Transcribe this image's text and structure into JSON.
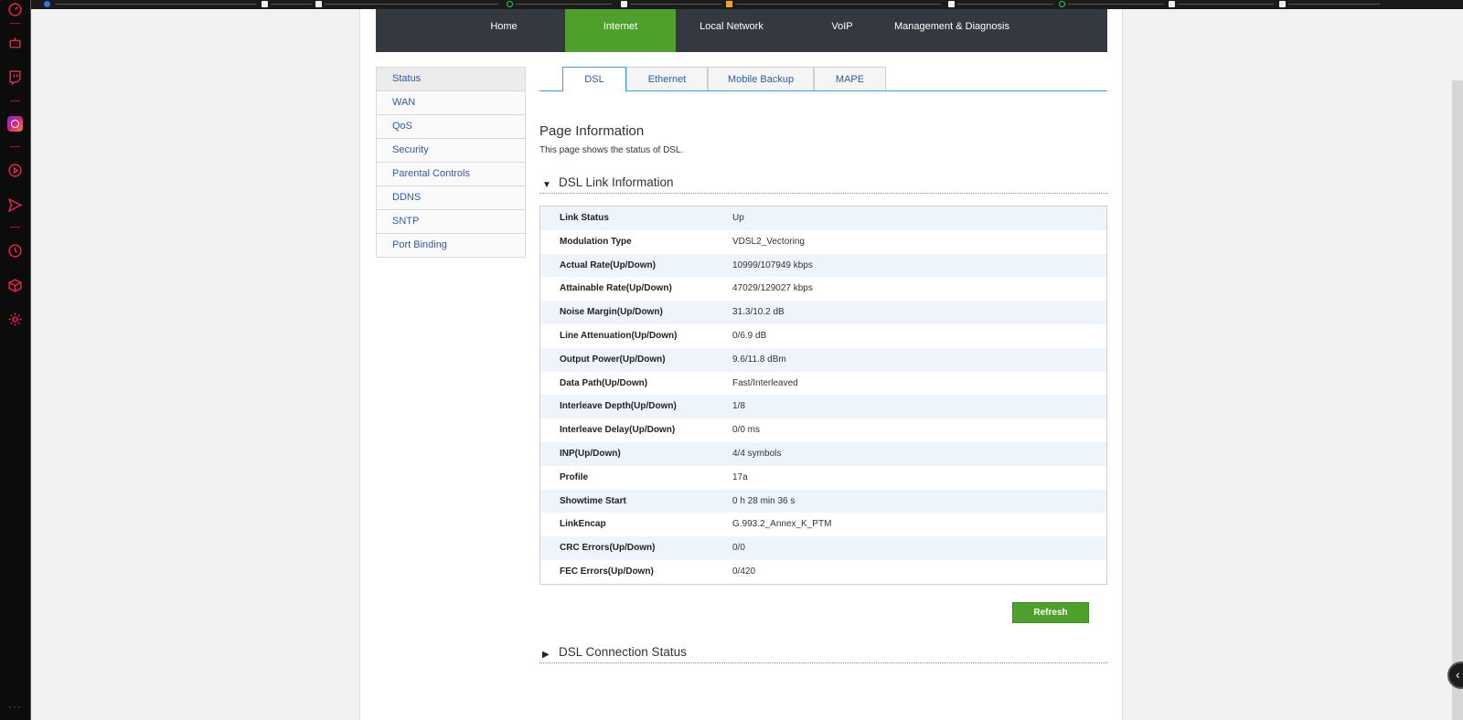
{
  "nav": {
    "items": [
      {
        "label": "Home",
        "active": false
      },
      {
        "label": "Internet",
        "active": true
      },
      {
        "label": "Local Network",
        "active": false
      },
      {
        "label": "VoIP",
        "active": false
      },
      {
        "label": "Management & Diagnosis",
        "active": false
      }
    ]
  },
  "sidebar": {
    "items": [
      {
        "label": "Status",
        "active": true
      },
      {
        "label": "WAN",
        "active": false
      },
      {
        "label": "QoS",
        "active": false
      },
      {
        "label": "Security",
        "active": false
      },
      {
        "label": "Parental Controls",
        "active": false
      },
      {
        "label": "DDNS",
        "active": false
      },
      {
        "label": "SNTP",
        "active": false
      },
      {
        "label": "Port Binding",
        "active": false
      }
    ]
  },
  "tabs": [
    {
      "label": "DSL",
      "active": true
    },
    {
      "label": "Ethernet",
      "active": false
    },
    {
      "label": "Mobile Backup",
      "active": false
    },
    {
      "label": "MAPE",
      "active": false
    }
  ],
  "page": {
    "title": "Page Information",
    "description": "This page shows the status of DSL."
  },
  "dsl_link": {
    "title": "DSL Link Information",
    "rows": [
      {
        "label": "Link Status",
        "value": "Up"
      },
      {
        "label": "Modulation Type",
        "value": "VDSL2_Vectoring"
      },
      {
        "label": "Actual Rate(Up/Down)",
        "value": "10999/107949 kbps"
      },
      {
        "label": "Attainable Rate(Up/Down)",
        "value": "47029/129027 kbps"
      },
      {
        "label": "Noise Margin(Up/Down)",
        "value": "31.3/10.2 dB"
      },
      {
        "label": "Line Attenuation(Up/Down)",
        "value": "0/6.9 dB"
      },
      {
        "label": "Output Power(Up/Down)",
        "value": "9.6/11.8 dBm"
      },
      {
        "label": "Data Path(Up/Down)",
        "value": "Fast/Interleaved"
      },
      {
        "label": "Interleave Depth(Up/Down)",
        "value": "1/8"
      },
      {
        "label": "Interleave Delay(Up/Down)",
        "value": "0/0 ms"
      },
      {
        "label": "INP(Up/Down)",
        "value": "4/4 symbols"
      },
      {
        "label": "Profile",
        "value": "17a"
      },
      {
        "label": "Showtime Start",
        "value": "0 h 28 min 36 s"
      },
      {
        "label": "LinkEncap",
        "value": "G.993.2_Annex_K_PTM"
      },
      {
        "label": "CRC Errors(Up/Down)",
        "value": "0/0"
      },
      {
        "label": "FEC Errors(Up/Down)",
        "value": "0/420"
      }
    ],
    "refresh_label": "Refresh"
  },
  "dsl_connection": {
    "title": "DSL Connection Status"
  },
  "colors": {
    "nav_bg": "#33393e",
    "accent_green": "#4e9f2b",
    "link_blue": "#2e5aa5",
    "tab_border": "#41a0c6",
    "row_alt": "#eef4fb",
    "rail_red": "#e02a44"
  },
  "icons": {
    "rail": [
      "speedometer-icon",
      "robot-icon",
      "twitch-icon",
      "instagram-icon",
      "play-circle-icon",
      "send-icon",
      "clock-icon",
      "cube-icon",
      "gear-icon",
      "more-icon"
    ],
    "section_expanded": "triangle-down-icon",
    "section_collapsed": "triangle-right-icon"
  }
}
